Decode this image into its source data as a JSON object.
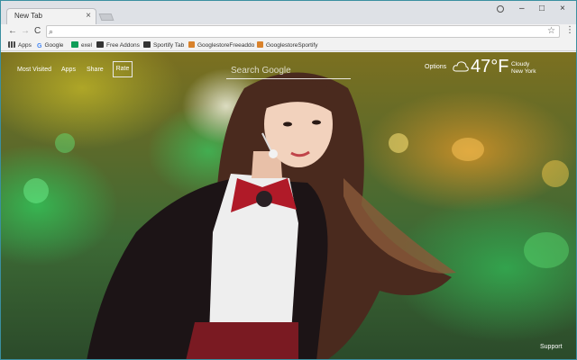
{
  "browser": {
    "tab_title": "New Tab",
    "tab_close": "×",
    "window_controls": {
      "minimize": "–",
      "maximize": "□",
      "close": "×"
    },
    "nav": {
      "back": "←",
      "forward": "→",
      "reload": "C"
    },
    "omnibox": {
      "value": "",
      "search_glyph": "⌕",
      "star": "☆",
      "menu": "⋮"
    },
    "bookmarks": [
      {
        "label": "Apps",
        "icon": "apps-grid-icon",
        "color": "#4a4a4a"
      },
      {
        "label": "Google",
        "icon": "google-icon",
        "color": "#4285f4"
      },
      {
        "label": "exel",
        "icon": "sheets-icon",
        "color": "#0f9d58"
      },
      {
        "label": "Free Addons",
        "icon": "addons-icon",
        "color": "#333333"
      },
      {
        "label": "Sportify Tab",
        "icon": "sportify-icon",
        "color": "#333333"
      },
      {
        "label": "GooglestoreFreeaddo",
        "icon": "store-icon",
        "color": "#d9822b"
      },
      {
        "label": "GooglestoreSportify",
        "icon": "store-icon",
        "color": "#d9822b"
      }
    ]
  },
  "newtab": {
    "links": [
      "Most Visited",
      "Apps",
      "Share"
    ],
    "rate_label": "Rate",
    "search_placeholder": "Search Google",
    "options_label": "Options",
    "weather": {
      "temp": "47°F",
      "condition": "Cloudy",
      "city": "New York",
      "icon": "cloud-icon"
    },
    "support_label": "Support"
  },
  "colors": {
    "accent_border": "#3a8fa0",
    "chrome_bg": "#dee1e6"
  }
}
